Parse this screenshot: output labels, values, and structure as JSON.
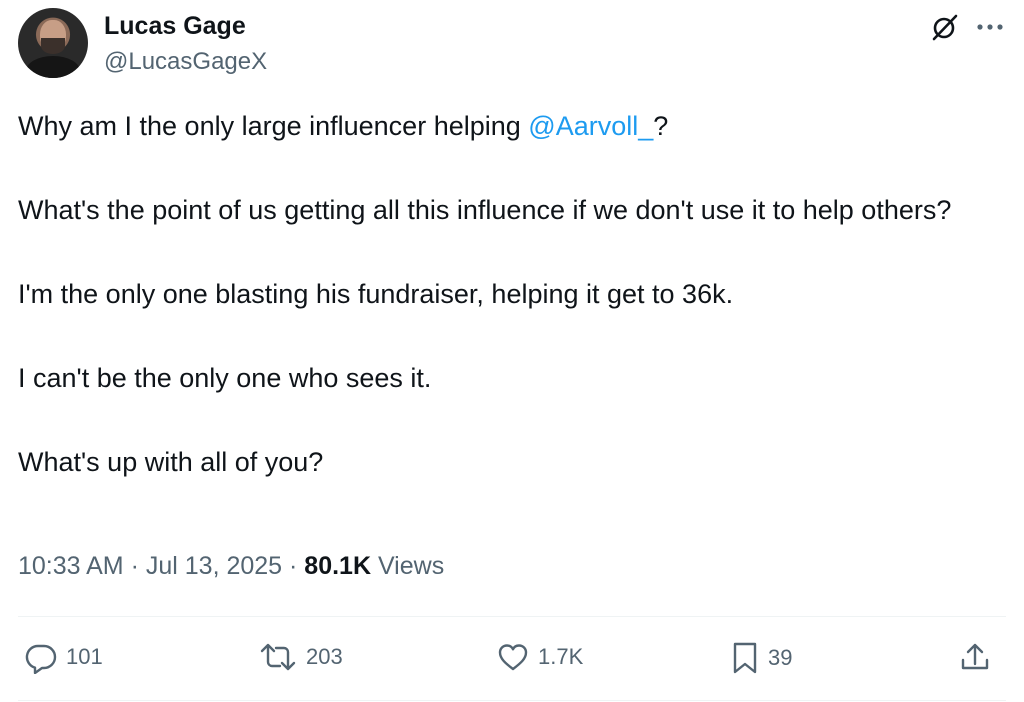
{
  "author": {
    "name": "Lucas Gage",
    "handle": "@LucasGageX"
  },
  "tweet": {
    "line1_before": "Why am I the only large influencer helping ",
    "line1_mention": "@Aarvoll_",
    "line1_after": "?",
    "para2": "What's the point of us getting all this influence if we don't use it to help others?",
    "para3": "I'm the only one blasting his fundraiser, helping it get to 36k.",
    "para4": "I can't be the only one who sees it.",
    "para5": "What's up with all of you?"
  },
  "meta": {
    "time": "10:33 AM",
    "sep1": " · ",
    "date": "Jul 13, 2025",
    "sep2": " · ",
    "views_count": "80.1K",
    "views_label": " Views"
  },
  "actions": {
    "replies": "101",
    "reposts": "203",
    "likes": "1.7K",
    "bookmarks": "39"
  },
  "icons": [
    "grok-icon",
    "more-icon",
    "reply-icon",
    "repost-icon",
    "like-icon",
    "bookmark-icon",
    "share-icon"
  ],
  "colors": {
    "text": "#0f1419",
    "secondary": "#536471",
    "link": "#1d9bf0",
    "divider": "#eff3f4"
  }
}
